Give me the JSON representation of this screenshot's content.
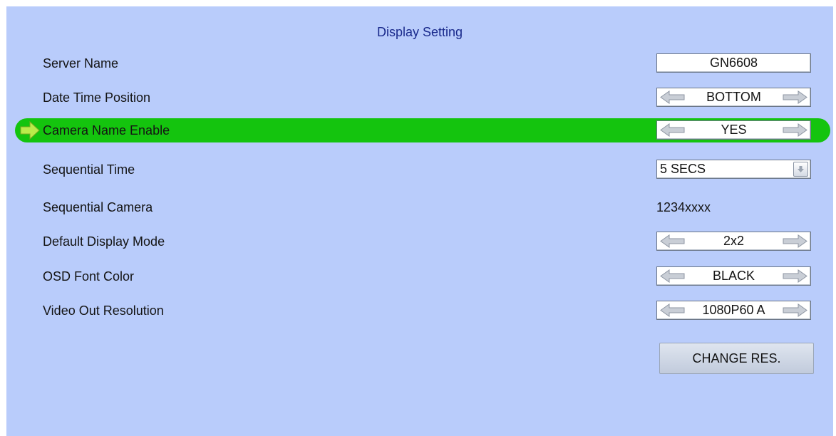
{
  "title": "Display Setting",
  "rows": {
    "server_name": {
      "label": "Server Name",
      "value": "GN6608"
    },
    "date_time_position": {
      "label": "Date Time Position",
      "value": "BOTTOM"
    },
    "camera_name_enable": {
      "label": "Camera Name Enable",
      "value": "YES",
      "selected": true
    },
    "sequential_time": {
      "label": "Sequential Time",
      "value": "5 SECS"
    },
    "sequential_camera": {
      "label": "Sequential Camera",
      "value": "1234xxxx"
    },
    "default_display_mode": {
      "label": "Default Display Mode",
      "value": "2x2"
    },
    "osd_font_color": {
      "label": "OSD Font Color",
      "value": "BLACK"
    },
    "video_out_resolution": {
      "label": "Video Out Resolution",
      "value": "1080P60 A"
    }
  },
  "change_res_label": "CHANGE RES.",
  "icons": {
    "selection_pointer": "arrow-right-icon",
    "spinner_previous": "arrow-left-icon",
    "spinner_next": "arrow-right-icon",
    "dropdown": "chevron-down-icon"
  },
  "colors": {
    "background": "#b9ccfb",
    "title": "#1a2a8c",
    "highlight": "#14c40e",
    "pointer": "#b9ec4a"
  }
}
